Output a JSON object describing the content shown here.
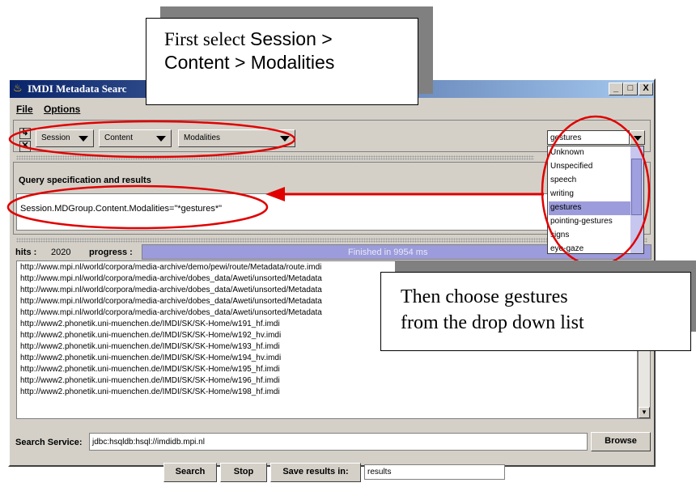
{
  "window": {
    "title": "IMDI Metadata Search",
    "title_visible": "IMDI Metadata Searc",
    "controls": {
      "minimize": "_",
      "maximize": "□",
      "close": "X"
    }
  },
  "menu": {
    "file": "File",
    "options": "Options"
  },
  "query_builder": {
    "session": "Session",
    "content": "Content",
    "modalities": "Modalities",
    "value_selected": "gestures",
    "value_options": [
      "Unknown",
      "Unspecified",
      "speech",
      "writing",
      "gestures",
      "pointing-gestures",
      "signs",
      "eye-gaze"
    ]
  },
  "query_spec": {
    "title": "Query specification and results",
    "text": "Session.MDGroup.Content.Modalities=\"*gestures*\""
  },
  "status": {
    "hits_label": "hits :",
    "hits_value": "2020",
    "progress_label": "progress :",
    "progress_text": "Finished in 9954 ms",
    "progress_fraction": 1.0
  },
  "results": [
    "http://www.mpi.nl/world/corpora/media-archive/demo/pewi/route/Metadata/route.imdi",
    "http://www.mpi.nl/world/corpora/media-archive/dobes_data/Aweti/unsorted/Metadata",
    "http://www.mpi.nl/world/corpora/media-archive/dobes_data/Aweti/unsorted/Metadata",
    "http://www.mpi.nl/world/corpora/media-archive/dobes_data/Aweti/unsorted/Metadata",
    "http://www.mpi.nl/world/corpora/media-archive/dobes_data/Aweti/unsorted/Metadata",
    "http://www2.phonetik.uni-muenchen.de/IMDI/SK/SK-Home/w191_hf.imdi",
    "http://www2.phonetik.uni-muenchen.de/IMDI/SK/SK-Home/w192_hv.imdi",
    "http://www2.phonetik.uni-muenchen.de/IMDI/SK/SK-Home/w193_hf.imdi",
    "http://www2.phonetik.uni-muenchen.de/IMDI/SK/SK-Home/w194_hv.imdi",
    "http://www2.phonetik.uni-muenchen.de/IMDI/SK/SK-Home/w195_hf.imdi",
    "http://www2.phonetik.uni-muenchen.de/IMDI/SK/SK-Home/w196_hf.imdi",
    "http://www2.phonetik.uni-muenchen.de/IMDI/SK/SK-Home/w198_hf.imdi"
  ],
  "service": {
    "label": "Search Service:",
    "value": "jdbc:hsqldb:hsql://imdidb.mpi.nl",
    "browse": "Browse"
  },
  "actions": {
    "search": "Search",
    "stop": "Stop",
    "save_label": "Save results in:",
    "save_value": "results"
  },
  "callouts": {
    "first_a": "First select ",
    "first_b": "Session >",
    "first_line2": "Content > Modalities",
    "then_line1": "Then choose gestures",
    "then_line2": "from the drop down list"
  },
  "colors": {
    "annotation": "#e00000",
    "selection": "#9c9cdc",
    "window_bg": "#d4d0c8",
    "titlebar": "#0a246a"
  }
}
